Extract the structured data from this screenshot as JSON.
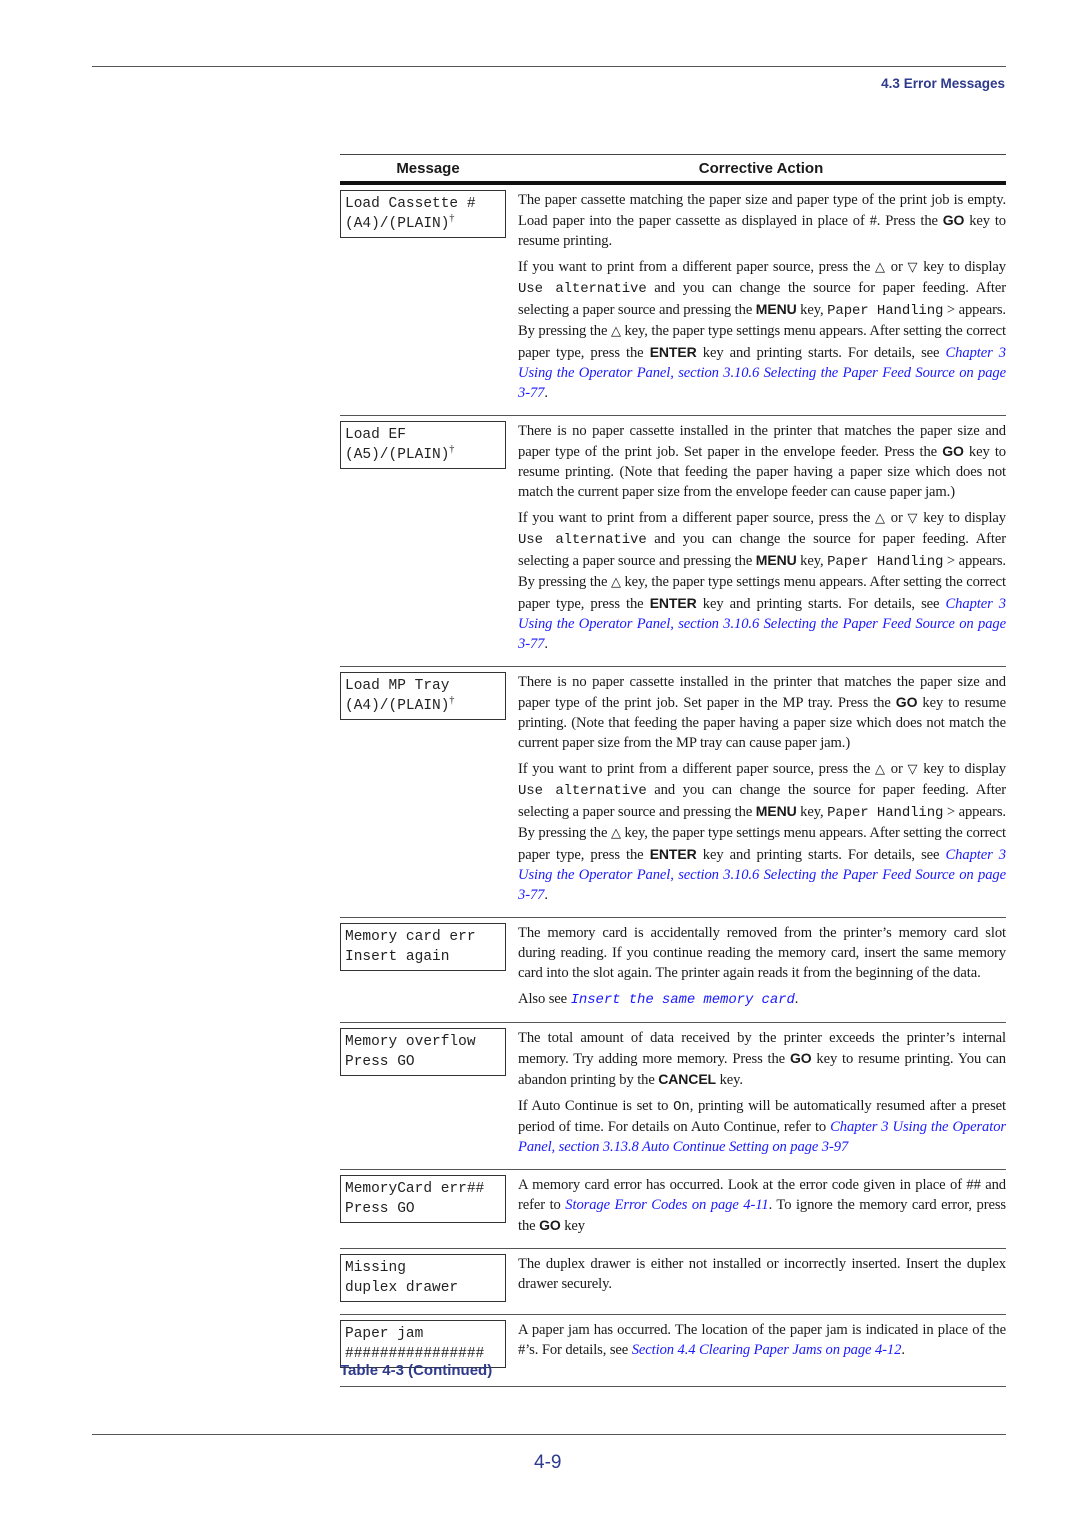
{
  "header": {
    "section": "4.3 Error Messages"
  },
  "table": {
    "col_message": "Message",
    "col_action": "Corrective Action",
    "rows": [
      {
        "lcd1": "Load Cassette #",
        "lcd2": "(A4)/(PLAIN)",
        "dagger": "†",
        "p1": {
          "t1": "The paper cassette matching the paper size and paper type of the print job is empty. Load paper into the paper cassette as displayed in place of #. Press the ",
          "k1": "GO",
          "t2": " key to resume printing."
        },
        "p2": {
          "t1": "If you want to print from a different paper source, press the ",
          "up": "△",
          "t2": " or ",
          "down": "▽",
          "t3": " key to display ",
          "m1": "Use alternative",
          "t4": " and you can change the source for paper feeding. After selecting a paper source and pressing the ",
          "k1": "MENU",
          "t5": " key, ",
          "m2": "Paper Handling",
          "t6": " > appears. By pressing the ",
          "up2": "△",
          "t7": " key, the paper type settings menu appears. After setting the correct paper type, press the ",
          "k2": "ENTER",
          "t8": " key and printing starts. For details, see ",
          "link": "Chapter 3 Using the Operator Panel, section 3.10.6 Selecting the Paper Feed Source on page 3-77",
          "t9": "."
        }
      },
      {
        "lcd1": "Load EF",
        "lcd2": "(A5)/(PLAIN)",
        "dagger": "†",
        "p1": {
          "t1": "There is no paper cassette installed in the printer that matches the paper size and paper type of the print job. Set paper in the envelope feeder. Press the ",
          "k1": "GO",
          "t2": " key to resume printing. (Note that feeding the paper having a paper size which does not match the current paper size from the envelope feeder can cause paper jam.)"
        },
        "p2": {
          "t1": "If you want to print from a different paper source, press the ",
          "up": "△",
          "t2": " or ",
          "down": "▽",
          "t3": " key to display ",
          "m1": "Use alternative",
          "t4": " and you can change the source for paper feeding. After selecting a paper source and pressing the ",
          "k1": "MENU",
          "t5": " key, ",
          "m2": "Paper Handling",
          "t6": " > appears. By pressing the ",
          "up2": "△",
          "t7": " key, the paper type settings menu appears. After setting the correct paper type, press the ",
          "k2": "ENTER",
          "t8": " key and printing starts. For details, see ",
          "link": "Chapter 3 Using the Operator Panel, section 3.10.6 Selecting the Paper Feed Source on page 3-77",
          "t9": "."
        }
      },
      {
        "lcd1": "Load MP Tray",
        "lcd2": "(A4)/(PLAIN)",
        "dagger": "†",
        "p1": {
          "t1": "There is no paper cassette installed in the printer that matches the paper size and paper type of the print job. Set paper in the MP tray. Press the ",
          "k1": "GO",
          "t2": " key to resume printing. (Note that feeding the paper having a paper size which does not match the current paper size from the MP tray can cause paper jam.)"
        },
        "p2": {
          "t1": "If you want to print from a different paper source, press the ",
          "up": "△",
          "t2": " or ",
          "down": "▽",
          "t3": " key to display ",
          "m1": "Use alternative",
          "t4": " and you can change the source for paper feeding. After selecting a paper source and pressing the ",
          "k1": "MENU",
          "t5": " key, ",
          "m2": "Paper Handling",
          "t6": " > appears. By pressing the ",
          "up2": "△",
          "t7": " key, the paper type settings menu appears. After setting the correct paper type, press the ",
          "k2": "ENTER",
          "t8": " key and printing starts. For details, see ",
          "link": "Chapter 3 Using the Operator Panel, section 3.10.6 Selecting the Paper Feed Source on page 3-77",
          "t9": "."
        }
      },
      {
        "lcd1": "Memory card err",
        "lcd2": "Insert again",
        "p1": "The memory card is accidentally removed from the printer’s memory card slot during reading. If you continue reading the memory card, insert the same memory card into the slot again. The printer again reads it from the beginning of the data.",
        "p2": {
          "t1": "Also see ",
          "mlink": "Insert the same memory card",
          "t2": "."
        }
      },
      {
        "lcd1": "Memory overflow",
        "lcd2": "Press GO",
        "p1": {
          "t1": "The total amount of data received by the printer exceeds the printer’s internal memory. Try adding more memory. Press the ",
          "k1": "GO",
          "t2": " key to resume printing. You can abandon printing by the ",
          "k2": "CANCEL",
          "t3": " key."
        },
        "p2": {
          "t1": "If Auto Continue is set to ",
          "m1": "On",
          "t2": ", printing will be automatically resumed after a preset period of time. For details on Auto Continue, refer to ",
          "link": "Chapter 3 Using the Operator Panel, section 3.13.8 Auto Continue Setting on page 3-97"
        }
      },
      {
        "lcd1": "MemoryCard err##",
        "lcd2": "Press GO",
        "p1": {
          "t1": "A memory card error has occurred. Look at the error code given in place of ## and refer to ",
          "link": "Storage Error Codes on page 4-11",
          "t2": ". To ignore the memory card error, press the ",
          "k1": "GO",
          "t3": " key"
        }
      },
      {
        "lcd1": "Missing",
        "lcd2": "duplex drawer",
        "p1": "The duplex drawer is either not installed or incorrectly inserted. Insert the duplex drawer securely."
      },
      {
        "lcd1": "Paper jam",
        "lcd2": "################",
        "p1": {
          "t1": "A paper jam has occurred. The location of the paper jam is indicated in place of the #’s. For details, see ",
          "link": "Section 4.4 Clearing Paper Jams on page 4-12",
          "t2": "."
        }
      }
    ]
  },
  "caption": "Table 4-3  (Continued)",
  "footer": {
    "page_number": "4-9"
  },
  "colors": {
    "heading_blue": "#2e3a8c",
    "link_blue": "#1a1aff"
  }
}
